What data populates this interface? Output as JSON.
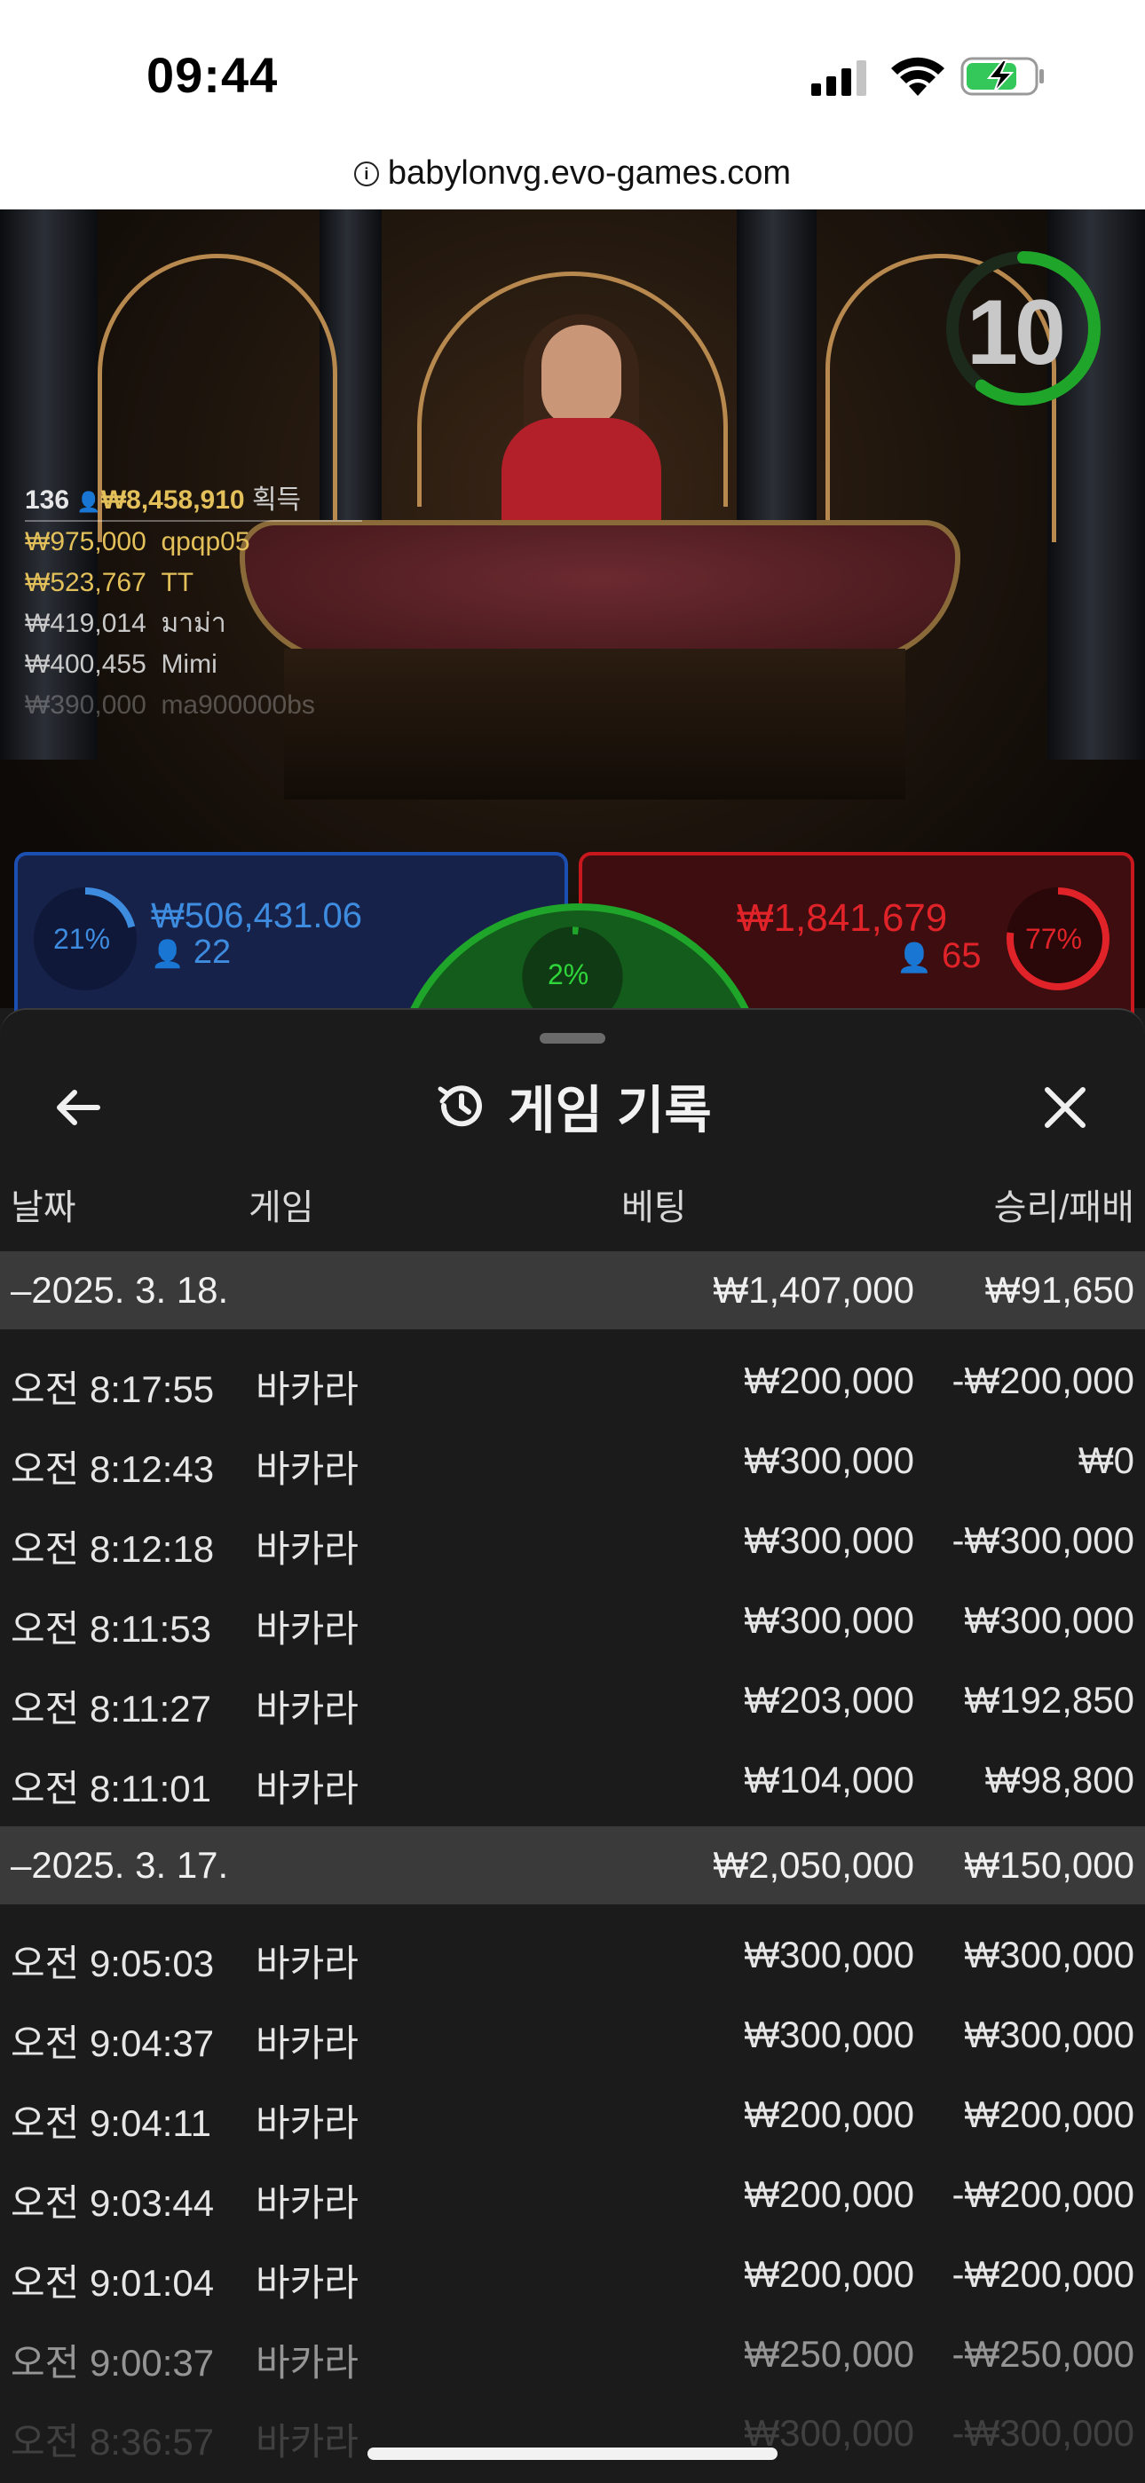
{
  "status_bar": {
    "time": "09:44",
    "url": "babylonvg.evo-games.com"
  },
  "game": {
    "timer": "10",
    "timer_fraction": 0.6,
    "leaderboard": {
      "count": "136",
      "total": "₩8,458,910",
      "total_label": "획득",
      "entries": [
        {
          "amount": "₩975,000",
          "name": "qpqp05"
        },
        {
          "amount": "₩523,767",
          "name": "TT"
        },
        {
          "amount": "₩419,014",
          "name": "มาม่า"
        },
        {
          "amount": "₩400,455",
          "name": "Mimi"
        },
        {
          "amount": "₩390,000",
          "name": "ma900000bs"
        }
      ]
    },
    "player": {
      "percent": "21%",
      "percent_value": 0.21,
      "amount": "₩506,431.06",
      "players": "22",
      "color": "#3e8ce0"
    },
    "tie": {
      "percent": "2%",
      "percent_value": 0.02,
      "color": "#1fa52a"
    },
    "banker": {
      "percent": "77%",
      "percent_value": 0.77,
      "amount": "₩1,841,679",
      "players": "65",
      "color": "#e02328"
    }
  },
  "history": {
    "title": "게임 기록",
    "columns": {
      "date": "날짜",
      "game": "게임",
      "bet": "베팅",
      "winloss": "승리/패배"
    },
    "groups": [
      {
        "date": "–2025. 3. 18.",
        "bet_total": "₩1,407,000",
        "win_total": "₩91,650",
        "rows": [
          {
            "time": "오전 8:17:55",
            "game": "바카라",
            "bet": "₩200,000",
            "result": "-₩200,000"
          },
          {
            "time": "오전 8:12:43",
            "game": "바카라",
            "bet": "₩300,000",
            "result": "₩0"
          },
          {
            "time": "오전 8:12:18",
            "game": "바카라",
            "bet": "₩300,000",
            "result": "-₩300,000"
          },
          {
            "time": "오전 8:11:53",
            "game": "바카라",
            "bet": "₩300,000",
            "result": "₩300,000"
          },
          {
            "time": "오전 8:11:27",
            "game": "바카라",
            "bet": "₩203,000",
            "result": "₩192,850"
          },
          {
            "time": "오전 8:11:01",
            "game": "바카라",
            "bet": "₩104,000",
            "result": "₩98,800"
          }
        ]
      },
      {
        "date": "–2025. 3. 17.",
        "bet_total": "₩2,050,000",
        "win_total": "₩150,000",
        "rows": [
          {
            "time": "오전 9:05:03",
            "game": "바카라",
            "bet": "₩300,000",
            "result": "₩300,000"
          },
          {
            "time": "오전 9:04:37",
            "game": "바카라",
            "bet": "₩300,000",
            "result": "₩300,000"
          },
          {
            "time": "오전 9:04:11",
            "game": "바카라",
            "bet": "₩200,000",
            "result": "₩200,000"
          },
          {
            "time": "오전 9:03:44",
            "game": "바카라",
            "bet": "₩200,000",
            "result": "-₩200,000"
          },
          {
            "time": "오전 9:01:04",
            "game": "바카라",
            "bet": "₩200,000",
            "result": "-₩200,000"
          },
          {
            "time": "오전 9:00:37",
            "game": "바카라",
            "bet": "₩250,000",
            "result": "-₩250,000"
          },
          {
            "time": "오전 8:36:57",
            "game": "바카라",
            "bet": "₩300,000",
            "result": "-₩300,000"
          }
        ]
      }
    ]
  }
}
